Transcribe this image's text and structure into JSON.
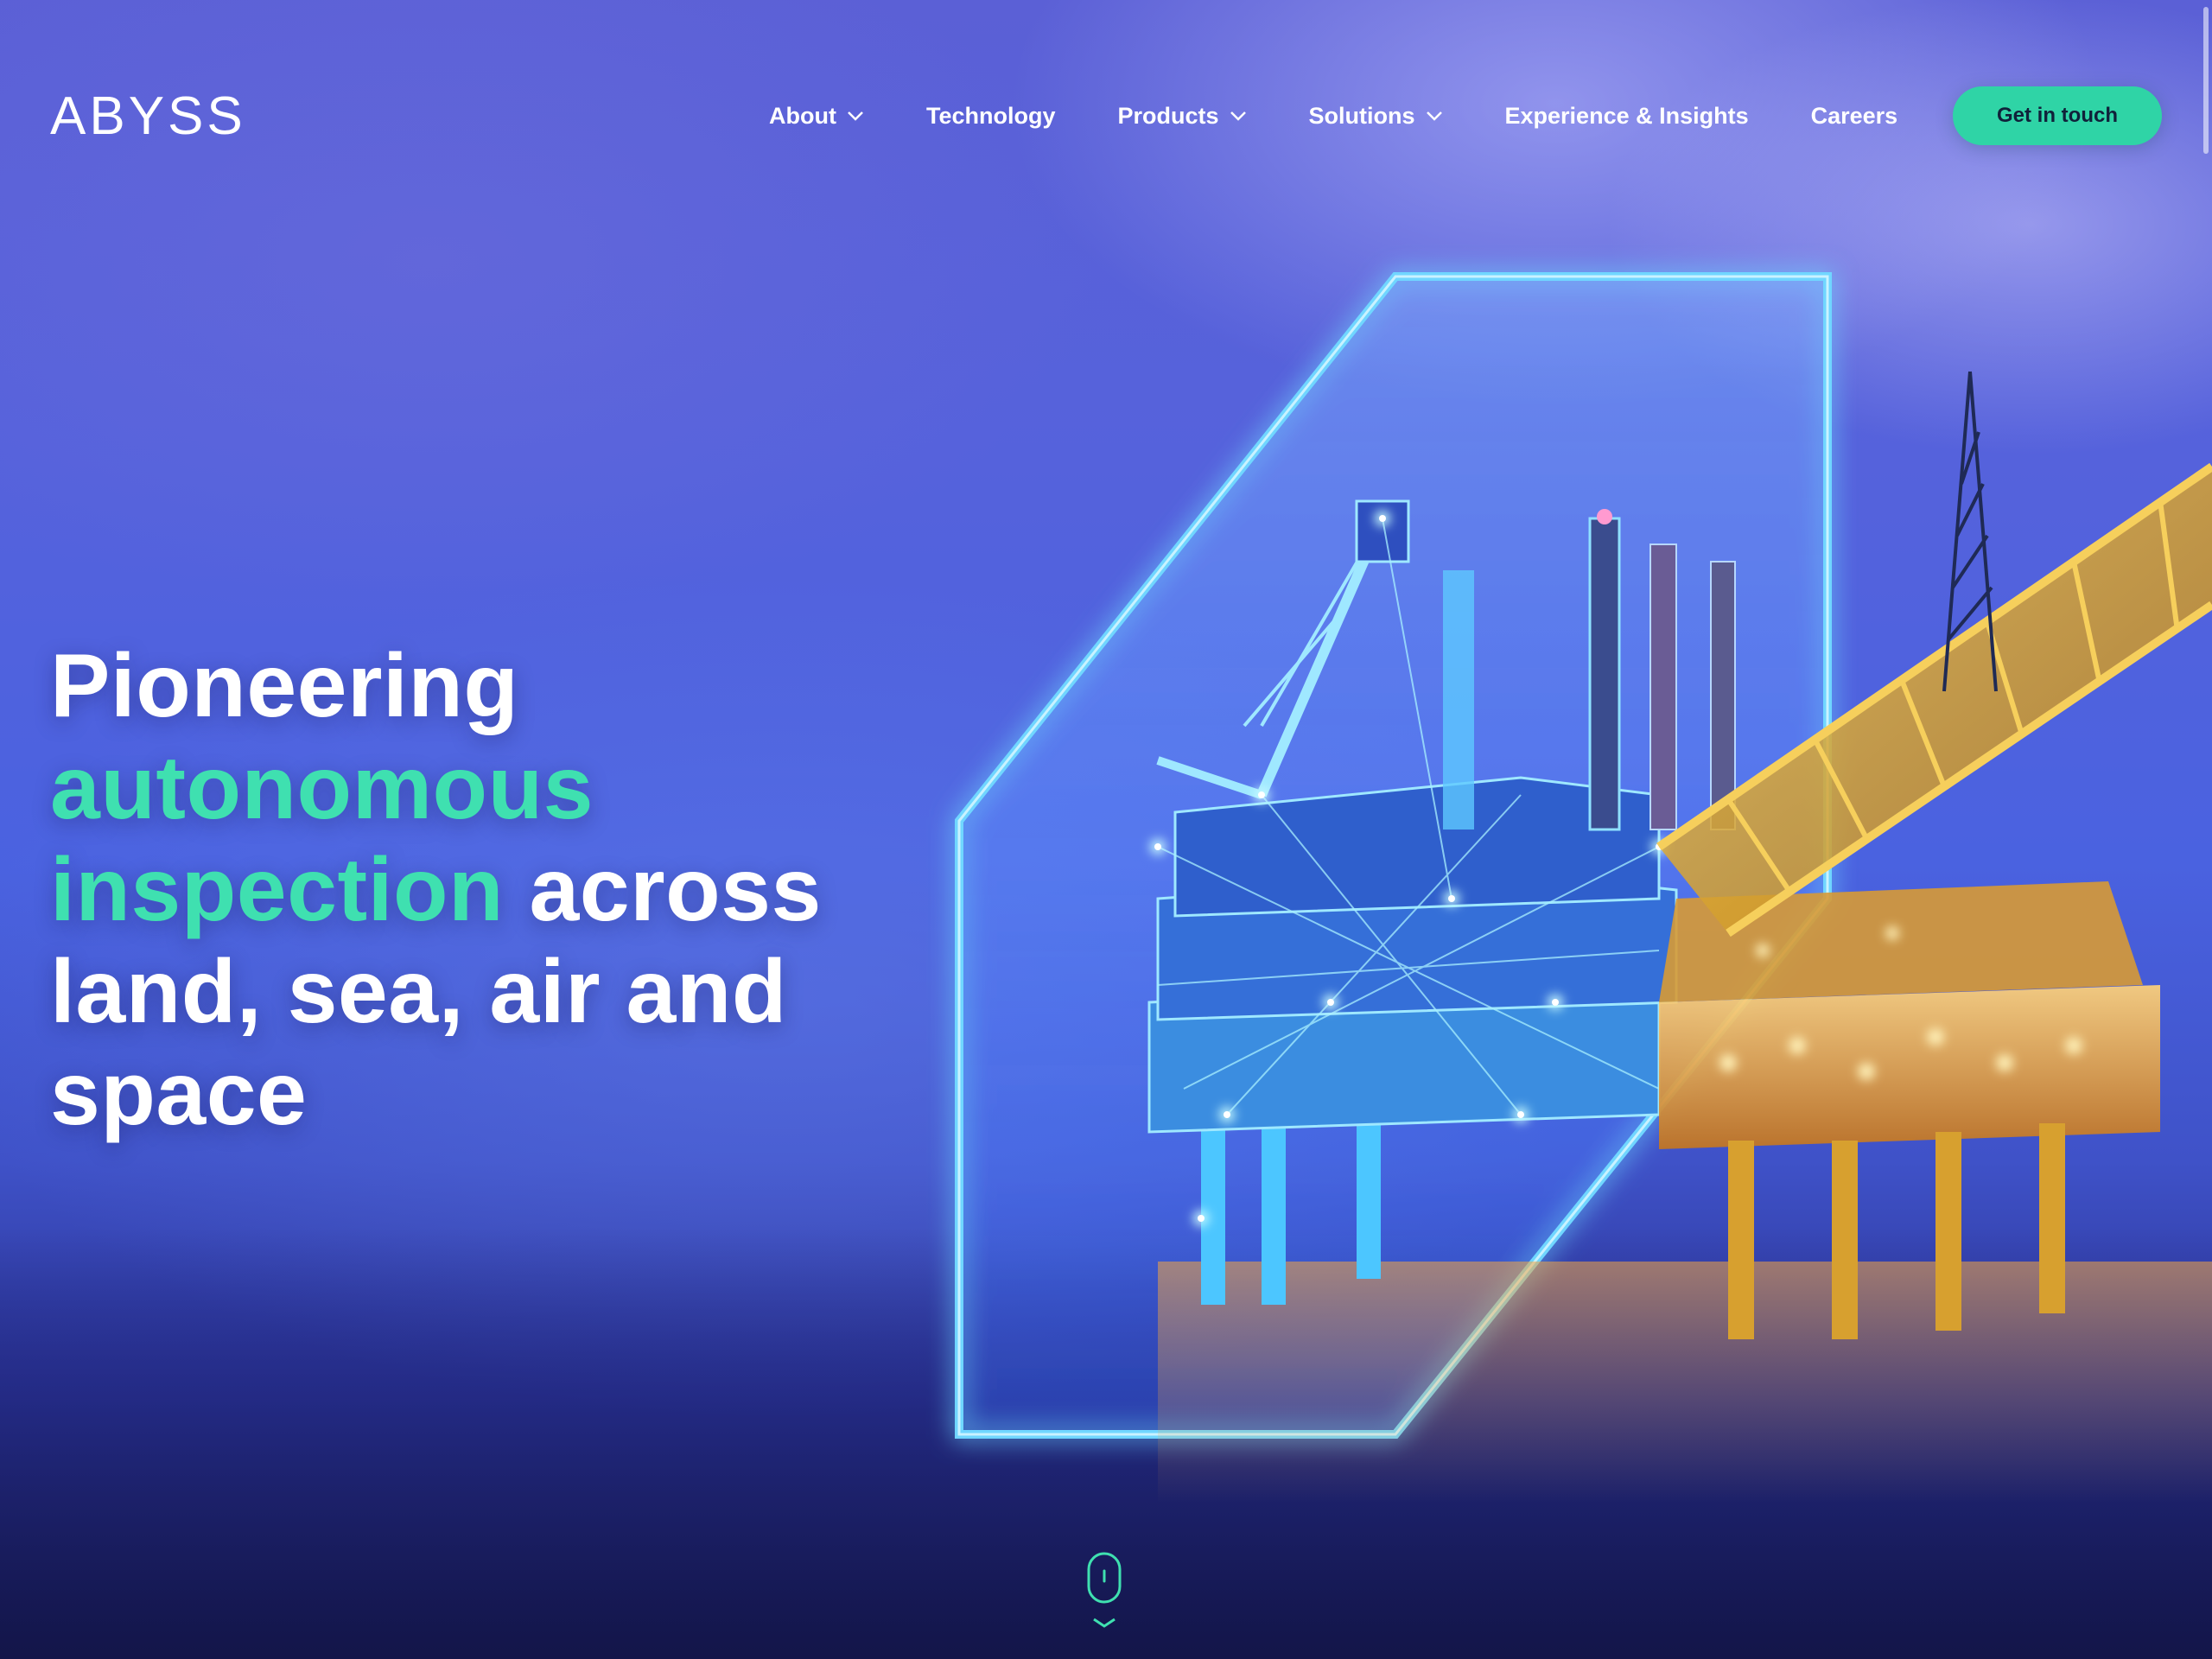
{
  "brand": {
    "name": "ABYSS"
  },
  "nav": {
    "items": [
      {
        "label": "About",
        "has_dropdown": true
      },
      {
        "label": "Technology",
        "has_dropdown": false
      },
      {
        "label": "Products",
        "has_dropdown": true
      },
      {
        "label": "Solutions",
        "has_dropdown": true
      },
      {
        "label": "Experience & Insights",
        "has_dropdown": false
      },
      {
        "label": "Careers",
        "has_dropdown": false
      }
    ],
    "cta_label": "Get in touch"
  },
  "hero": {
    "line1": "Pioneering",
    "line2_accent": "autonomous",
    "line3_accent": "inspection",
    "line3_rest": " across",
    "line4": "land, sea, air and",
    "line5": "space"
  },
  "icons": {
    "chevron": "chevron-down-icon",
    "scroll": "mouse-scroll-icon"
  },
  "colors": {
    "accent": "#3fe0b0",
    "cta_bg": "#2fd4a6",
    "frame_glow": "#5fd0ff",
    "structure_yellow": "#e6b23a"
  }
}
